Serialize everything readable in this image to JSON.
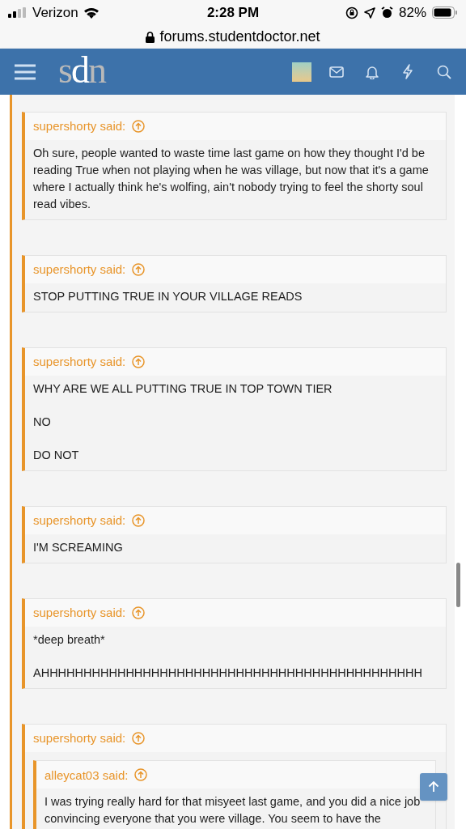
{
  "status_bar": {
    "carrier": "Verizon",
    "time": "2:28 PM",
    "battery": "82%"
  },
  "url_bar": {
    "url": "forums.studentdoctor.net"
  },
  "header": {
    "logo": "sdn"
  },
  "quotes": [
    {
      "author": "supershorty said:",
      "paragraphs": [
        "Oh sure, people wanted to waste time last game on how they thought I'd be reading True when not playing when he was village, but now that it's a game where I actually think he's wolfing, ain't nobody trying to feel the shorty soul read vibes."
      ]
    },
    {
      "author": "supershorty said:",
      "paragraphs": [
        "STOP PUTTING TRUE IN YOUR VILLAGE READS"
      ]
    },
    {
      "author": "supershorty said:",
      "paragraphs": [
        "WHY ARE WE ALL PUTTING TRUE IN TOP TOWN TIER",
        "NO",
        "DO NOT"
      ]
    },
    {
      "author": "supershorty said:",
      "paragraphs": [
        "I'M SCREAMING"
      ]
    },
    {
      "author": "supershorty said:",
      "paragraphs": [
        "*deep breath*",
        "AHHHHHHHHHHHHHHHHHHHHHHHHHHHHHHHHHHHHHHHHHHHHH"
      ]
    },
    {
      "author": "supershorty said:",
      "nested": {
        "author": "alleycat03 said:",
        "paragraphs": [
          "I was trying really hard for that misyeet last game, and you did a nice job convincing everyone that you were village. You seem to have the"
        ]
      }
    }
  ]
}
